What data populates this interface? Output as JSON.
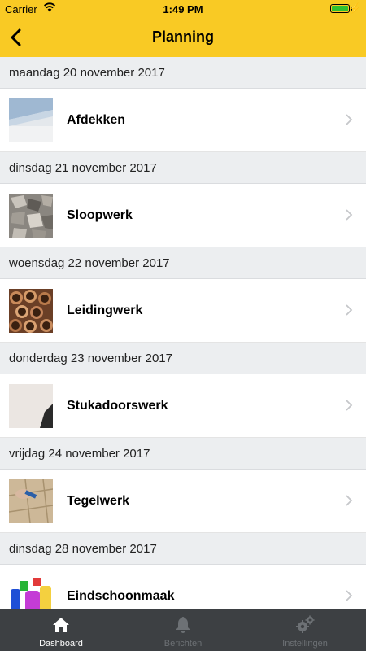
{
  "status_bar": {
    "carrier": "Carrier",
    "time": "1:49 PM",
    "battery_color": "#2fc12f"
  },
  "header": {
    "title": "Planning",
    "back_icon": "chevron-left-icon",
    "background": "#f9ca24"
  },
  "sections": [
    {
      "date": "maandag 20 november 2017",
      "item": {
        "label": "Afdekken",
        "thumbnail": "covering-roll-thumbnail"
      }
    },
    {
      "date": "dinsdag 21 november 2017",
      "item": {
        "label": "Sloopwerk",
        "thumbnail": "demolition-rubble-thumbnail"
      }
    },
    {
      "date": "woensdag 22 november 2017",
      "item": {
        "label": "Leidingwerk",
        "thumbnail": "copper-pipes-thumbnail"
      }
    },
    {
      "date": "donderdag 23 november 2017",
      "item": {
        "label": "Stukadoorswerk",
        "thumbnail": "plaster-wall-thumbnail"
      }
    },
    {
      "date": "vrijdag 24 november 2017",
      "item": {
        "label": "Tegelwerk",
        "thumbnail": "tiling-thumbnail"
      }
    },
    {
      "date": "dinsdag 28 november 2017",
      "item": {
        "label": "Eindschoonmaak",
        "thumbnail": "cleaning-supplies-thumbnail"
      }
    }
  ],
  "tabbar": {
    "tabs": [
      {
        "label": "Dashboard",
        "icon": "home-icon",
        "active": true
      },
      {
        "label": "Berichten",
        "icon": "bell-icon",
        "active": false
      },
      {
        "label": "Instellingen",
        "icon": "gears-icon",
        "active": false
      }
    ],
    "background": "#3d4043"
  }
}
